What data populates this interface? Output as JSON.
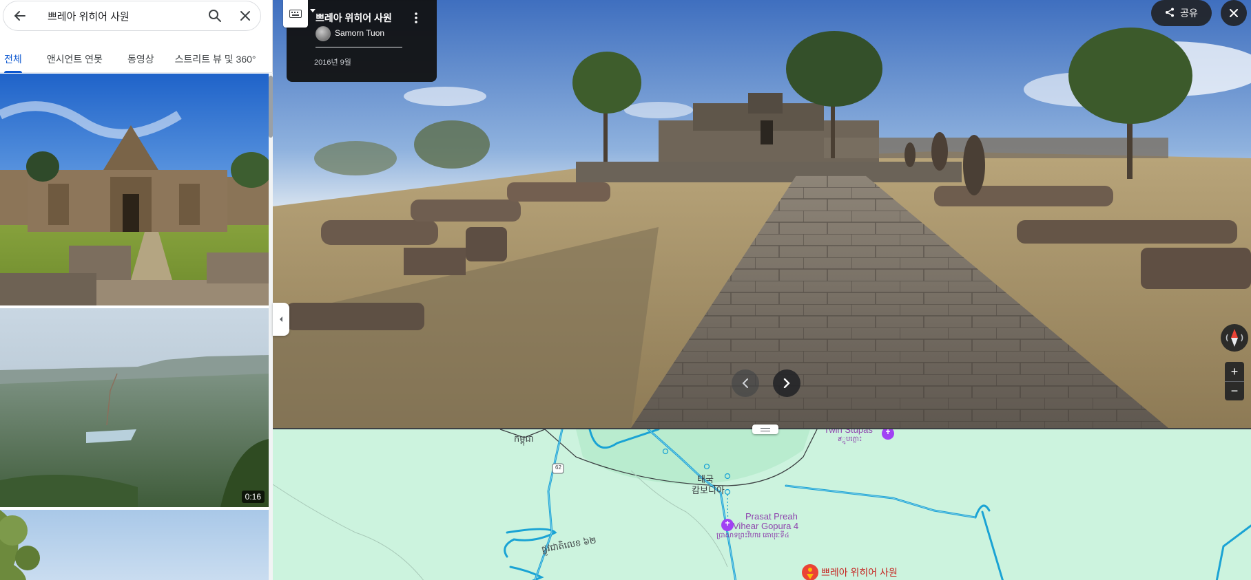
{
  "search": {
    "back_icon": "arrow-left-icon",
    "query": "쁘레아 위히어 사원",
    "search_icon": "search-icon",
    "clear_icon": "close-icon"
  },
  "tabs": [
    {
      "label": "전체",
      "active": true
    },
    {
      "label": "앤시언트 연못",
      "active": false
    },
    {
      "label": "동영상",
      "active": false
    },
    {
      "label": "스트리트 뷰 및 360°",
      "active": false
    }
  ],
  "thumbnails": [
    {
      "kind": "photo"
    },
    {
      "kind": "video",
      "duration": "0:16"
    },
    {
      "kind": "photo"
    }
  ],
  "photo_card": {
    "title": "쁘레아 위히어 사원",
    "author": "Samorn Tuon",
    "date": "2016년 9월"
  },
  "toolbar": {
    "share_label": "공유",
    "share_icon": "share-icon",
    "close_icon": "close-icon",
    "keyboard_icon": "keyboard-icon"
  },
  "map": {
    "labels": {
      "top_khmer": "កម្ពុជា",
      "road_62": "62",
      "twin_stupas": "Twin Stupas",
      "twin_stupas_sub": "ส្តូបភ្លោះ",
      "border_top": "태국",
      "border_bottom": "캄보디아",
      "gopura_line1": "Prasat Preah",
      "gopura_line2": "Vihear Gopura 4",
      "gopura_khmer": "ប្រាសាទព្រះវិហារ គោបុរៈទី៤",
      "bottom_khmer": "ផ្លូវជាតិលេខ ៦២",
      "temple": "쁘레아 위히어 사원"
    }
  },
  "colors": {
    "accent": "#0b57d0",
    "map_bg": "#ccf3de",
    "poi": "#8e44ad",
    "pin": "#c5221f",
    "water": "#1aa3d4"
  }
}
